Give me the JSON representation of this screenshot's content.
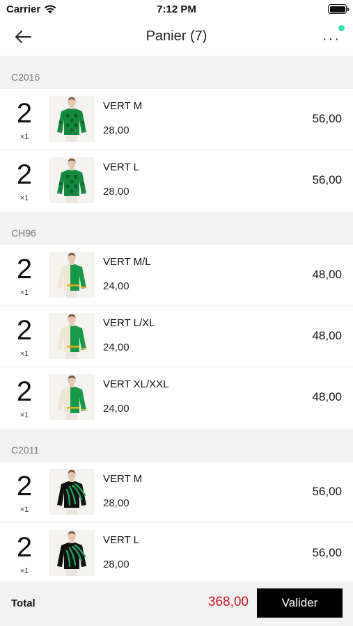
{
  "status_bar": {
    "carrier": "Carrier",
    "time": "7:12 PM"
  },
  "nav": {
    "title": "Panier (7)",
    "more": "···"
  },
  "groups": [
    {
      "code": "C2016",
      "items": [
        {
          "qty": "2",
          "multiplier": "×1",
          "variant": "VERT M",
          "unit_price": "28,00",
          "total": "56,00",
          "image": "green-patterned-sweater"
        },
        {
          "qty": "2",
          "multiplier": "×1",
          "variant": "VERT L",
          "unit_price": "28,00",
          "total": "56,00",
          "image": "green-patterned-sweater"
        }
      ]
    },
    {
      "code": "CH96",
      "items": [
        {
          "qty": "2",
          "multiplier": "×1",
          "variant": "VERT M/L",
          "unit_price": "24,00",
          "total": "48,00",
          "image": "green-colorblock-sweater"
        },
        {
          "qty": "2",
          "multiplier": "×1",
          "variant": "VERT L/XL",
          "unit_price": "24,00",
          "total": "48,00",
          "image": "green-colorblock-sweater"
        },
        {
          "qty": "2",
          "multiplier": "×1",
          "variant": "VERT XL/XXL",
          "unit_price": "24,00",
          "total": "48,00",
          "image": "green-colorblock-sweater"
        }
      ]
    },
    {
      "code": "C2011",
      "items": [
        {
          "qty": "2",
          "multiplier": "×1",
          "variant": "VERT M",
          "unit_price": "28,00",
          "total": "56,00",
          "image": "black-green-stripe-sweater"
        },
        {
          "qty": "2",
          "multiplier": "×1",
          "variant": "VERT L",
          "unit_price": "28,00",
          "total": "56,00",
          "image": "black-green-stripe-sweater"
        }
      ]
    }
  ],
  "footer": {
    "total_label": "Total",
    "total_value": "368,00",
    "validate_label": "Valider"
  },
  "colors": {
    "accent_red": "#d0142c",
    "notify_dot": "#3ee0b0",
    "section_bg": "#f2f2f2"
  }
}
